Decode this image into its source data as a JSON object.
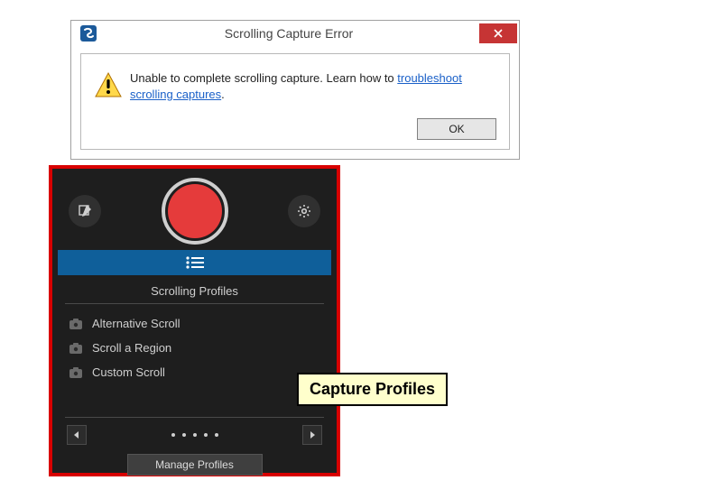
{
  "dialog": {
    "title": "Scrolling Capture Error",
    "message_text": "Unable to complete scrolling capture. Learn how to ",
    "link_text": "troubleshoot scrolling captures",
    "message_suffix": ".",
    "ok_label": "OK"
  },
  "panel": {
    "section_title": "Scrolling Profiles",
    "profiles": [
      "Alternative Scroll",
      "Scroll a Region",
      "Custom Scroll"
    ],
    "manage_label": "Manage Profiles"
  },
  "callout": {
    "label": "Capture Profiles"
  }
}
